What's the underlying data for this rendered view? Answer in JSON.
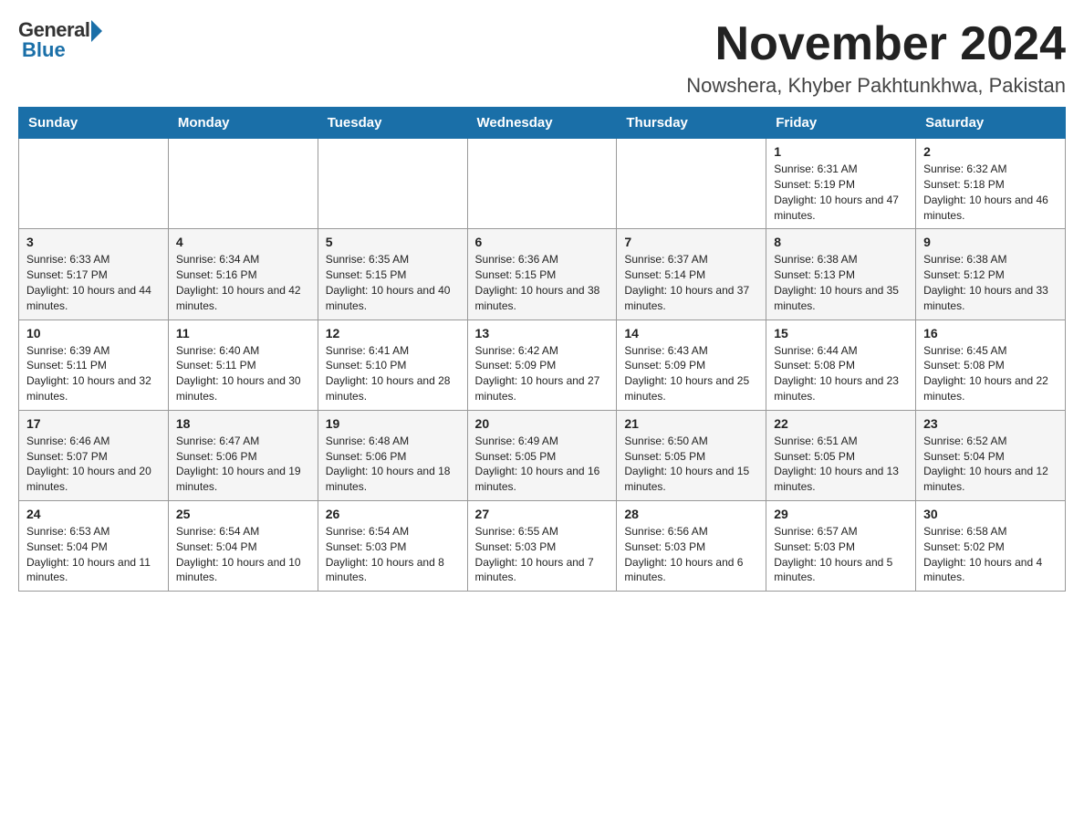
{
  "header": {
    "logo_general": "General",
    "logo_blue": "Blue",
    "title": "November 2024",
    "location": "Nowshera, Khyber Pakhtunkhwa, Pakistan"
  },
  "weekdays": [
    "Sunday",
    "Monday",
    "Tuesday",
    "Wednesday",
    "Thursday",
    "Friday",
    "Saturday"
  ],
  "weeks": [
    [
      {
        "day": "",
        "info": ""
      },
      {
        "day": "",
        "info": ""
      },
      {
        "day": "",
        "info": ""
      },
      {
        "day": "",
        "info": ""
      },
      {
        "day": "",
        "info": ""
      },
      {
        "day": "1",
        "info": "Sunrise: 6:31 AM\nSunset: 5:19 PM\nDaylight: 10 hours and 47 minutes."
      },
      {
        "day": "2",
        "info": "Sunrise: 6:32 AM\nSunset: 5:18 PM\nDaylight: 10 hours and 46 minutes."
      }
    ],
    [
      {
        "day": "3",
        "info": "Sunrise: 6:33 AM\nSunset: 5:17 PM\nDaylight: 10 hours and 44 minutes."
      },
      {
        "day": "4",
        "info": "Sunrise: 6:34 AM\nSunset: 5:16 PM\nDaylight: 10 hours and 42 minutes."
      },
      {
        "day": "5",
        "info": "Sunrise: 6:35 AM\nSunset: 5:15 PM\nDaylight: 10 hours and 40 minutes."
      },
      {
        "day": "6",
        "info": "Sunrise: 6:36 AM\nSunset: 5:15 PM\nDaylight: 10 hours and 38 minutes."
      },
      {
        "day": "7",
        "info": "Sunrise: 6:37 AM\nSunset: 5:14 PM\nDaylight: 10 hours and 37 minutes."
      },
      {
        "day": "8",
        "info": "Sunrise: 6:38 AM\nSunset: 5:13 PM\nDaylight: 10 hours and 35 minutes."
      },
      {
        "day": "9",
        "info": "Sunrise: 6:38 AM\nSunset: 5:12 PM\nDaylight: 10 hours and 33 minutes."
      }
    ],
    [
      {
        "day": "10",
        "info": "Sunrise: 6:39 AM\nSunset: 5:11 PM\nDaylight: 10 hours and 32 minutes."
      },
      {
        "day": "11",
        "info": "Sunrise: 6:40 AM\nSunset: 5:11 PM\nDaylight: 10 hours and 30 minutes."
      },
      {
        "day": "12",
        "info": "Sunrise: 6:41 AM\nSunset: 5:10 PM\nDaylight: 10 hours and 28 minutes."
      },
      {
        "day": "13",
        "info": "Sunrise: 6:42 AM\nSunset: 5:09 PM\nDaylight: 10 hours and 27 minutes."
      },
      {
        "day": "14",
        "info": "Sunrise: 6:43 AM\nSunset: 5:09 PM\nDaylight: 10 hours and 25 minutes."
      },
      {
        "day": "15",
        "info": "Sunrise: 6:44 AM\nSunset: 5:08 PM\nDaylight: 10 hours and 23 minutes."
      },
      {
        "day": "16",
        "info": "Sunrise: 6:45 AM\nSunset: 5:08 PM\nDaylight: 10 hours and 22 minutes."
      }
    ],
    [
      {
        "day": "17",
        "info": "Sunrise: 6:46 AM\nSunset: 5:07 PM\nDaylight: 10 hours and 20 minutes."
      },
      {
        "day": "18",
        "info": "Sunrise: 6:47 AM\nSunset: 5:06 PM\nDaylight: 10 hours and 19 minutes."
      },
      {
        "day": "19",
        "info": "Sunrise: 6:48 AM\nSunset: 5:06 PM\nDaylight: 10 hours and 18 minutes."
      },
      {
        "day": "20",
        "info": "Sunrise: 6:49 AM\nSunset: 5:05 PM\nDaylight: 10 hours and 16 minutes."
      },
      {
        "day": "21",
        "info": "Sunrise: 6:50 AM\nSunset: 5:05 PM\nDaylight: 10 hours and 15 minutes."
      },
      {
        "day": "22",
        "info": "Sunrise: 6:51 AM\nSunset: 5:05 PM\nDaylight: 10 hours and 13 minutes."
      },
      {
        "day": "23",
        "info": "Sunrise: 6:52 AM\nSunset: 5:04 PM\nDaylight: 10 hours and 12 minutes."
      }
    ],
    [
      {
        "day": "24",
        "info": "Sunrise: 6:53 AM\nSunset: 5:04 PM\nDaylight: 10 hours and 11 minutes."
      },
      {
        "day": "25",
        "info": "Sunrise: 6:54 AM\nSunset: 5:04 PM\nDaylight: 10 hours and 10 minutes."
      },
      {
        "day": "26",
        "info": "Sunrise: 6:54 AM\nSunset: 5:03 PM\nDaylight: 10 hours and 8 minutes."
      },
      {
        "day": "27",
        "info": "Sunrise: 6:55 AM\nSunset: 5:03 PM\nDaylight: 10 hours and 7 minutes."
      },
      {
        "day": "28",
        "info": "Sunrise: 6:56 AM\nSunset: 5:03 PM\nDaylight: 10 hours and 6 minutes."
      },
      {
        "day": "29",
        "info": "Sunrise: 6:57 AM\nSunset: 5:03 PM\nDaylight: 10 hours and 5 minutes."
      },
      {
        "day": "30",
        "info": "Sunrise: 6:58 AM\nSunset: 5:02 PM\nDaylight: 10 hours and 4 minutes."
      }
    ]
  ]
}
